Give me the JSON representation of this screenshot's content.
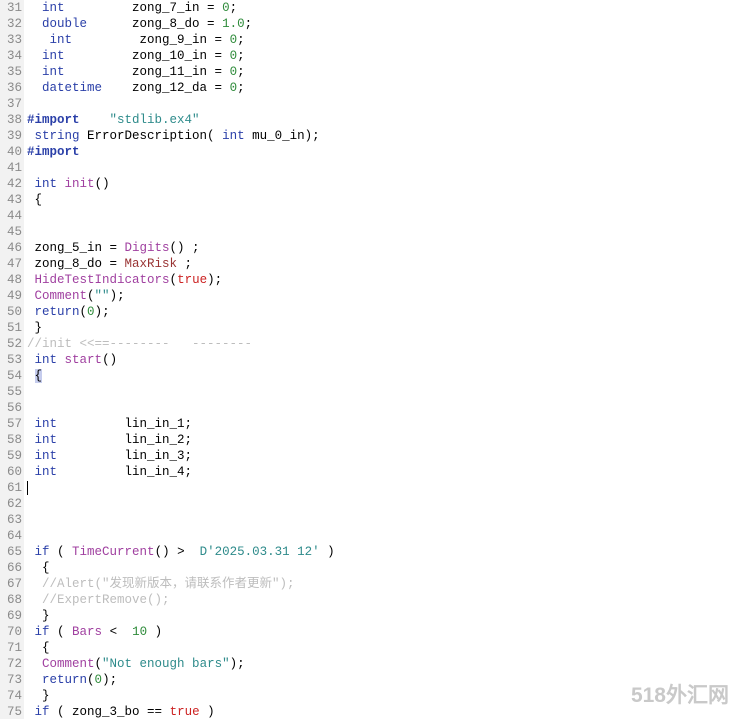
{
  "editor": {
    "language": "MQL4",
    "first_line_number": 31,
    "gutter_bg": "#f2f2f2",
    "background": "#ffffff",
    "caret": {
      "line": 61,
      "column": 0
    },
    "brace_match": {
      "line": 54,
      "text": "{"
    }
  },
  "palette": {
    "line_number": "#8a8a8a",
    "plain": "#000000",
    "type": "#2a3fa8",
    "keyword": "#2a3fa8",
    "preprocessor": "#2a3fa8",
    "number": "#2e8b3a",
    "string": "#2e8b8b",
    "function": "#a040a0",
    "predefined_variable": "#993333",
    "comment": "#bdbdbd",
    "boolean": "#cc2222",
    "datetime_literal": "#2e8b8b",
    "brace_match_bg": "#c5cced"
  },
  "watermark": {
    "text": "518外汇网",
    "color": "#c9c9c9"
  },
  "lines": [
    {
      "n": 31,
      "tokens": [
        {
          "t": "  ",
          "c": "plain"
        },
        {
          "t": "int",
          "c": "type"
        },
        {
          "t": "         zong_7_in = ",
          "c": "plain"
        },
        {
          "t": "0",
          "c": "num"
        },
        {
          "t": ";",
          "c": "plain"
        }
      ]
    },
    {
      "n": 32,
      "tokens": [
        {
          "t": "  ",
          "c": "plain"
        },
        {
          "t": "double",
          "c": "type"
        },
        {
          "t": "      zong_8_do = ",
          "c": "plain"
        },
        {
          "t": "1.0",
          "c": "num"
        },
        {
          "t": ";",
          "c": "plain"
        }
      ]
    },
    {
      "n": 33,
      "tokens": [
        {
          "t": "   ",
          "c": "plain"
        },
        {
          "t": "int",
          "c": "type"
        },
        {
          "t": "         zong_9_in = ",
          "c": "plain"
        },
        {
          "t": "0",
          "c": "num"
        },
        {
          "t": ";",
          "c": "plain"
        }
      ]
    },
    {
      "n": 34,
      "tokens": [
        {
          "t": "  ",
          "c": "plain"
        },
        {
          "t": "int",
          "c": "type"
        },
        {
          "t": "         zong_10_in = ",
          "c": "plain"
        },
        {
          "t": "0",
          "c": "num"
        },
        {
          "t": ";",
          "c": "plain"
        }
      ]
    },
    {
      "n": 35,
      "tokens": [
        {
          "t": "  ",
          "c": "plain"
        },
        {
          "t": "int",
          "c": "type"
        },
        {
          "t": "         zong_11_in = ",
          "c": "plain"
        },
        {
          "t": "0",
          "c": "num"
        },
        {
          "t": ";",
          "c": "plain"
        }
      ]
    },
    {
      "n": 36,
      "tokens": [
        {
          "t": "  ",
          "c": "plain"
        },
        {
          "t": "datetime",
          "c": "type"
        },
        {
          "t": "    zong_12_da = ",
          "c": "plain"
        },
        {
          "t": "0",
          "c": "num"
        },
        {
          "t": ";",
          "c": "plain"
        }
      ]
    },
    {
      "n": 37,
      "tokens": []
    },
    {
      "n": 38,
      "tokens": [
        {
          "t": "#import",
          "c": "prep"
        },
        {
          "t": "    ",
          "c": "plain"
        },
        {
          "t": "\"stdlib.ex4\"",
          "c": "str"
        }
      ]
    },
    {
      "n": 39,
      "tokens": [
        {
          "t": " ",
          "c": "plain"
        },
        {
          "t": "string",
          "c": "type"
        },
        {
          "t": " ErrorDescription( ",
          "c": "plain"
        },
        {
          "t": "int",
          "c": "type"
        },
        {
          "t": " mu_0_in);",
          "c": "plain"
        }
      ]
    },
    {
      "n": 40,
      "tokens": [
        {
          "t": "#import",
          "c": "prep"
        }
      ]
    },
    {
      "n": 41,
      "tokens": []
    },
    {
      "n": 42,
      "tokens": [
        {
          "t": " ",
          "c": "plain"
        },
        {
          "t": "int",
          "c": "type"
        },
        {
          "t": " ",
          "c": "plain"
        },
        {
          "t": "init",
          "c": "fn"
        },
        {
          "t": "()",
          "c": "plain"
        }
      ]
    },
    {
      "n": 43,
      "tokens": [
        {
          "t": " {",
          "c": "plain"
        }
      ]
    },
    {
      "n": 44,
      "tokens": []
    },
    {
      "n": 45,
      "tokens": []
    },
    {
      "n": 46,
      "tokens": [
        {
          "t": " zong_5_in = ",
          "c": "plain"
        },
        {
          "t": "Digits",
          "c": "fn"
        },
        {
          "t": "() ;",
          "c": "plain"
        }
      ]
    },
    {
      "n": 47,
      "tokens": [
        {
          "t": " zong_8_do = ",
          "c": "plain"
        },
        {
          "t": "MaxRisk",
          "c": "var"
        },
        {
          "t": " ;",
          "c": "plain"
        }
      ]
    },
    {
      "n": 48,
      "tokens": [
        {
          "t": " ",
          "c": "plain"
        },
        {
          "t": "HideTestIndicators",
          "c": "fn"
        },
        {
          "t": "(",
          "c": "plain"
        },
        {
          "t": "true",
          "c": "bool"
        },
        {
          "t": ");",
          "c": "plain"
        }
      ]
    },
    {
      "n": 49,
      "tokens": [
        {
          "t": " ",
          "c": "plain"
        },
        {
          "t": "Comment",
          "c": "fn"
        },
        {
          "t": "(",
          "c": "plain"
        },
        {
          "t": "\"\"",
          "c": "str"
        },
        {
          "t": ");",
          "c": "plain"
        }
      ]
    },
    {
      "n": 50,
      "tokens": [
        {
          "t": " ",
          "c": "plain"
        },
        {
          "t": "return",
          "c": "kw"
        },
        {
          "t": "(",
          "c": "plain"
        },
        {
          "t": "0",
          "c": "num"
        },
        {
          "t": ");",
          "c": "plain"
        }
      ]
    },
    {
      "n": 51,
      "tokens": [
        {
          "t": " }",
          "c": "plain"
        }
      ]
    },
    {
      "n": 52,
      "tokens": [
        {
          "t": "//init <<==--------   --------",
          "c": "comment"
        }
      ]
    },
    {
      "n": 53,
      "tokens": [
        {
          "t": " ",
          "c": "plain"
        },
        {
          "t": "int",
          "c": "type"
        },
        {
          "t": " ",
          "c": "plain"
        },
        {
          "t": "start",
          "c": "fn"
        },
        {
          "t": "()",
          "c": "plain"
        }
      ]
    },
    {
      "n": 54,
      "tokens": [
        {
          "t": " ",
          "c": "plain"
        },
        {
          "t": "{",
          "c": "plain",
          "match": true
        }
      ]
    },
    {
      "n": 55,
      "tokens": []
    },
    {
      "n": 56,
      "tokens": []
    },
    {
      "n": 57,
      "tokens": [
        {
          "t": " ",
          "c": "plain"
        },
        {
          "t": "int",
          "c": "type"
        },
        {
          "t": "         lin_in_1;",
          "c": "plain"
        }
      ]
    },
    {
      "n": 58,
      "tokens": [
        {
          "t": " ",
          "c": "plain"
        },
        {
          "t": "int",
          "c": "type"
        },
        {
          "t": "         lin_in_2;",
          "c": "plain"
        }
      ]
    },
    {
      "n": 59,
      "tokens": [
        {
          "t": " ",
          "c": "plain"
        },
        {
          "t": "int",
          "c": "type"
        },
        {
          "t": "         lin_in_3;",
          "c": "plain"
        }
      ]
    },
    {
      "n": 60,
      "tokens": [
        {
          "t": " ",
          "c": "plain"
        },
        {
          "t": "int",
          "c": "type"
        },
        {
          "t": "         lin_in_4;",
          "c": "plain"
        }
      ]
    },
    {
      "n": 61,
      "tokens": []
    },
    {
      "n": 62,
      "tokens": []
    },
    {
      "n": 63,
      "tokens": []
    },
    {
      "n": 64,
      "tokens": []
    },
    {
      "n": 65,
      "tokens": [
        {
          "t": " ",
          "c": "plain"
        },
        {
          "t": "if",
          "c": "kw"
        },
        {
          "t": " ( ",
          "c": "plain"
        },
        {
          "t": "TimeCurrent",
          "c": "fn"
        },
        {
          "t": "() >  ",
          "c": "plain"
        },
        {
          "t": "D'2025.03.31 12'",
          "c": "date"
        },
        {
          "t": " )",
          "c": "plain"
        }
      ]
    },
    {
      "n": 66,
      "tokens": [
        {
          "t": "  {",
          "c": "plain"
        }
      ]
    },
    {
      "n": 67,
      "tokens": [
        {
          "t": "  //Alert(\"发现新版本，请联系作者更新\");",
          "c": "comment"
        }
      ]
    },
    {
      "n": 68,
      "tokens": [
        {
          "t": "  //ExpertRemove();",
          "c": "comment"
        }
      ]
    },
    {
      "n": 69,
      "tokens": [
        {
          "t": "  }",
          "c": "plain"
        }
      ]
    },
    {
      "n": 70,
      "tokens": [
        {
          "t": " ",
          "c": "plain"
        },
        {
          "t": "if",
          "c": "kw"
        },
        {
          "t": " ( ",
          "c": "plain"
        },
        {
          "t": "Bars",
          "c": "fn"
        },
        {
          "t": " <  ",
          "c": "plain"
        },
        {
          "t": "10",
          "c": "num"
        },
        {
          "t": " )",
          "c": "plain"
        }
      ]
    },
    {
      "n": 71,
      "tokens": [
        {
          "t": "  {",
          "c": "plain"
        }
      ]
    },
    {
      "n": 72,
      "tokens": [
        {
          "t": "  ",
          "c": "plain"
        },
        {
          "t": "Comment",
          "c": "fn"
        },
        {
          "t": "(",
          "c": "plain"
        },
        {
          "t": "\"Not enough bars\"",
          "c": "str"
        },
        {
          "t": ");",
          "c": "plain"
        }
      ]
    },
    {
      "n": 73,
      "tokens": [
        {
          "t": "  ",
          "c": "plain"
        },
        {
          "t": "return",
          "c": "kw"
        },
        {
          "t": "(",
          "c": "plain"
        },
        {
          "t": "0",
          "c": "num"
        },
        {
          "t": ");",
          "c": "plain"
        }
      ]
    },
    {
      "n": 74,
      "tokens": [
        {
          "t": "  }",
          "c": "plain"
        }
      ]
    },
    {
      "n": 75,
      "tokens": [
        {
          "t": " ",
          "c": "plain"
        },
        {
          "t": "if",
          "c": "kw"
        },
        {
          "t": " ( zong_3_bo == ",
          "c": "plain"
        },
        {
          "t": "true",
          "c": "bool"
        },
        {
          "t": " )",
          "c": "plain"
        }
      ]
    }
  ]
}
